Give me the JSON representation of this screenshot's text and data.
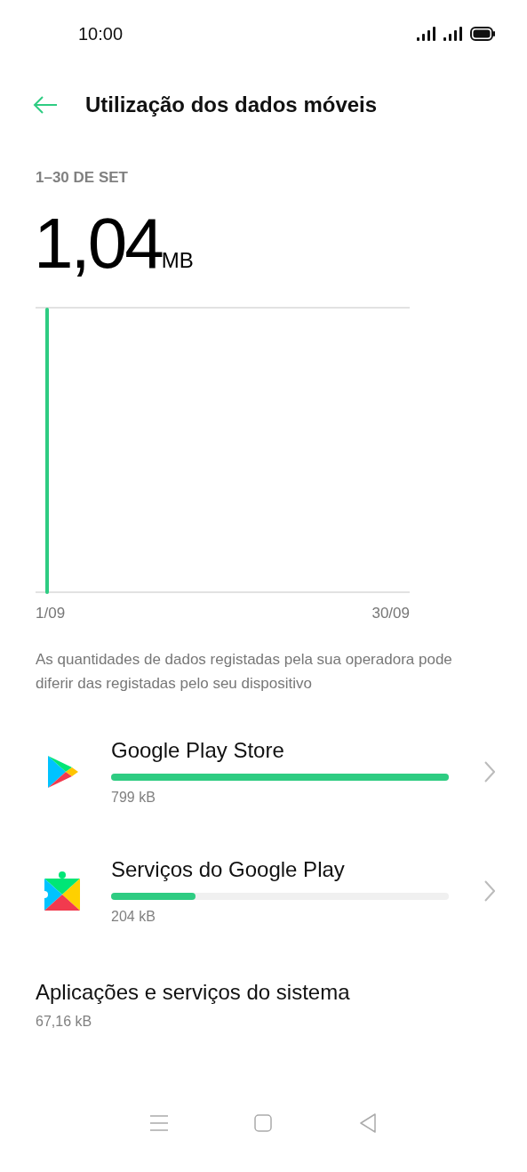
{
  "status_bar": {
    "time": "10:00"
  },
  "header": {
    "title": "Utilização dos dados móveis"
  },
  "period": "1–30 DE SET",
  "total": {
    "value": "1,04",
    "unit": "MB"
  },
  "chart": {
    "x_start": "1/09",
    "x_end": "30/09"
  },
  "note": "As quantidades de dados registadas pela sua operadora pode diferir das registadas pelo seu dispositivo",
  "apps": [
    {
      "name": "Google Play Store",
      "level": 1.0,
      "usage": "799 kB"
    },
    {
      "name": "Serviços do Google Play",
      "level": 0.25,
      "usage": "204 kB"
    }
  ],
  "system": {
    "name": "Aplicações e serviços do sistema",
    "usage": "67,16 kB"
  }
}
